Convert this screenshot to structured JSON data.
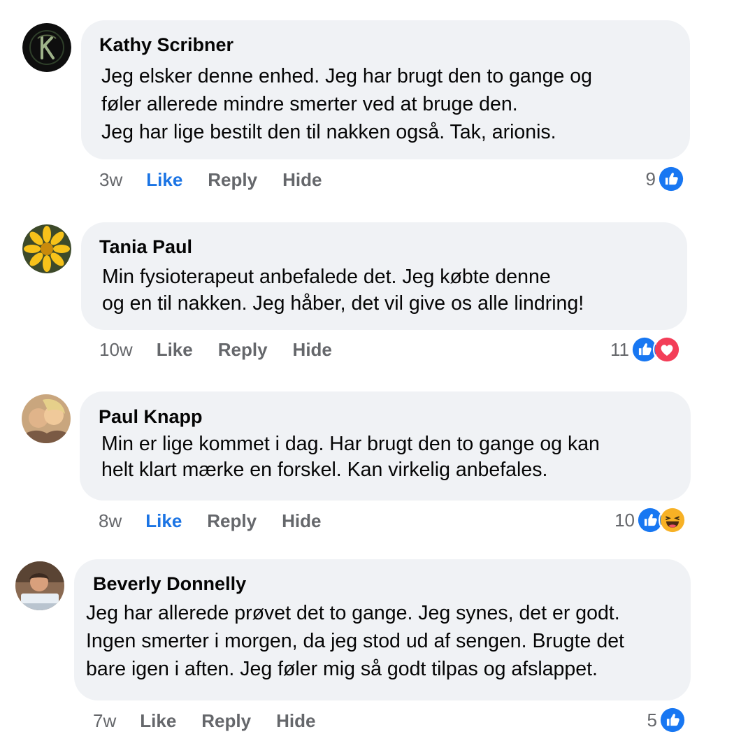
{
  "colors": {
    "bubble": "#f0f2f5",
    "like_blue": "#1b74e4",
    "meta_gray": "#65676b",
    "text": "#050505"
  },
  "comments": [
    {
      "author": "Kathy Scribner",
      "avatar_icon": "letter-k-emblem-avatar",
      "lines": [
        "Jeg elsker denne enhed. Jeg har brugt den to gange og",
        "føler allerede mindre smerter ved at bruge den.",
        "Jeg har lige bestilt den til nakken også. Tak, arionis."
      ],
      "time": "3w",
      "like_label": "Like",
      "like_active": true,
      "reply_label": "Reply",
      "hide_label": "Hide",
      "reaction_count": "9",
      "reactions": [
        "like-reaction-icon"
      ]
    },
    {
      "author": "Tania Paul",
      "avatar_icon": "sunflower-avatar",
      "lines": [
        "Min fysioterapeut anbefalede det. Jeg købte denne",
        "og en til nakken. Jeg håber, det vil give os alle lindring!"
      ],
      "time": "10w",
      "like_label": "Like",
      "like_active": false,
      "reply_label": "Reply",
      "hide_label": "Hide",
      "reaction_count": "11",
      "reactions": [
        "like-reaction-icon",
        "love-reaction-icon"
      ]
    },
    {
      "author": "Paul Knapp",
      "avatar_icon": "couple-photo-avatar",
      "lines": [
        "Min er lige kommet i dag. Har brugt den to gange og kan",
        "helt klart mærke en forskel. Kan virkelig anbefales."
      ],
      "time": "8w",
      "like_label": "Like",
      "like_active": true,
      "reply_label": "Reply",
      "hide_label": "Hide",
      "reaction_count": "10",
      "reactions": [
        "like-reaction-icon",
        "haha-reaction-icon"
      ]
    },
    {
      "author": "Beverly Donnelly",
      "avatar_icon": "person-photo-avatar",
      "lines": [
        "Jeg har allerede prøvet det to gange. Jeg synes, det er godt.",
        "Ingen smerter i morgen, da jeg stod ud af sengen. Brugte det",
        "bare igen i aften. Jeg føler mig så godt tilpas og afslappet."
      ],
      "time": "7w",
      "like_label": "Like",
      "like_active": false,
      "reply_label": "Reply",
      "hide_label": "Hide",
      "reaction_count": "5",
      "reactions": [
        "like-reaction-icon"
      ]
    }
  ]
}
